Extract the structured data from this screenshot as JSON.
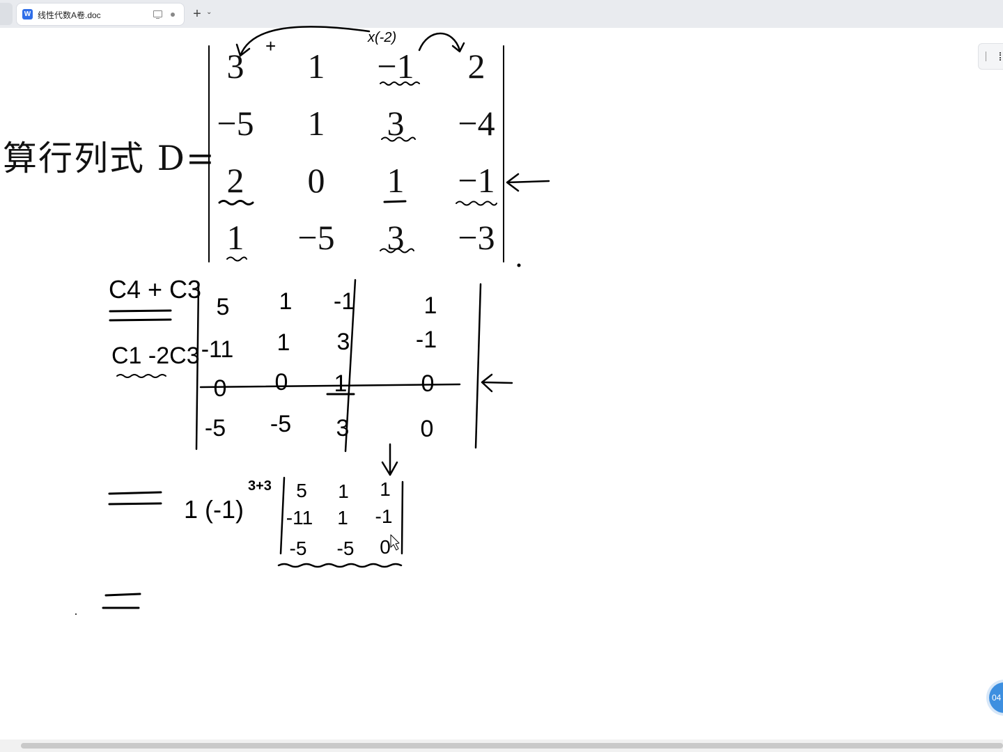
{
  "tab": {
    "title": "线性代数A卷.doc",
    "icon_letter": "W"
  },
  "new_tab_symbol": "+",
  "dropdown_symbol": "⌄",
  "timer_badge": "04",
  "accent_color": "#2f6ee8",
  "document": {
    "heading": "算行列式 D=",
    "matrix": [
      [
        "3",
        "1",
        "−1",
        "2"
      ],
      [
        "−5",
        "1",
        "3",
        "−4"
      ],
      [
        "2",
        "0",
        "1",
        "−1"
      ],
      [
        "1",
        "−5",
        "3",
        "−3"
      ]
    ]
  },
  "handwriting": {
    "top_note_plus": "+",
    "top_note_multiply": "x(-2)",
    "step1_op1": "C4 + C3",
    "step1_op2": "C1 -2C3",
    "step1_matrix": [
      [
        "5",
        "1",
        "-1",
        "1"
      ],
      [
        "-11",
        "1",
        "3",
        "-1"
      ],
      [
        "0",
        "0",
        "1",
        "0"
      ],
      [
        "-5",
        "-5",
        "3",
        "0"
      ]
    ],
    "step2_factor": "1 (-1)",
    "step2_exponent": "3+3",
    "step2_matrix": [
      [
        "5",
        "1",
        "1"
      ],
      [
        "-11",
        "1",
        "-1"
      ],
      [
        "-5",
        "-5",
        "0"
      ]
    ]
  }
}
